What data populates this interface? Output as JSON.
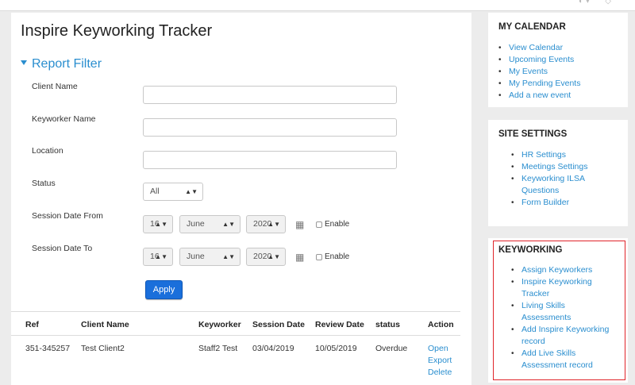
{
  "page": {
    "title": "Inspire Keyworking Tracker"
  },
  "filter": {
    "heading": "Report Filter",
    "client_name_label": "Client Name",
    "keyworker_name_label": "Keyworker Name",
    "location_label": "Location",
    "status_label": "Status",
    "status_value": "All",
    "date_from_label": "Session Date From",
    "date_to_label": "Session Date To",
    "from": {
      "day": "16",
      "month": "June",
      "year": "2020"
    },
    "to": {
      "day": "16",
      "month": "June",
      "year": "2020"
    },
    "enable_label": "Enable",
    "apply_label": "Apply"
  },
  "table": {
    "headers": {
      "ref": "Ref",
      "client": "Client Name",
      "keyworker": "Keyworker",
      "session": "Session Date",
      "review": "Review Date",
      "status": "status",
      "action": "Action"
    },
    "rows": [
      {
        "ref": "351-345257",
        "client": "Test Client2",
        "keyworker": "Staff2 Test",
        "session": "03/04/2019",
        "review": "10/05/2019",
        "status": "Overdue",
        "actions": [
          "Open",
          "Export",
          "Delete"
        ]
      }
    ]
  },
  "sidebar": {
    "calendar": {
      "title": "MY CALENDAR",
      "items": [
        "View Calendar",
        "Upcoming Events",
        "My Events",
        "My Pending Events",
        "Add a new event"
      ]
    },
    "settings": {
      "title": "SITE SETTINGS",
      "items": [
        "HR Settings",
        "Meetings Settings",
        "Keyworking ILSA",
        "Questions",
        "Form Builder"
      ]
    },
    "keyworking": {
      "title": "KEYWORKING",
      "items": [
        "Assign Keyworkers",
        "Inspire Keyworking",
        "Tracker",
        "Living Skills",
        "Assessments",
        "Add Inspire Keyworking",
        "record",
        "Add Live Skills",
        "Assessment record"
      ]
    }
  },
  "colors": {
    "link": "#2a8ecf",
    "primary_button": "#1a6fdb",
    "highlight_border": "#e0242a"
  }
}
